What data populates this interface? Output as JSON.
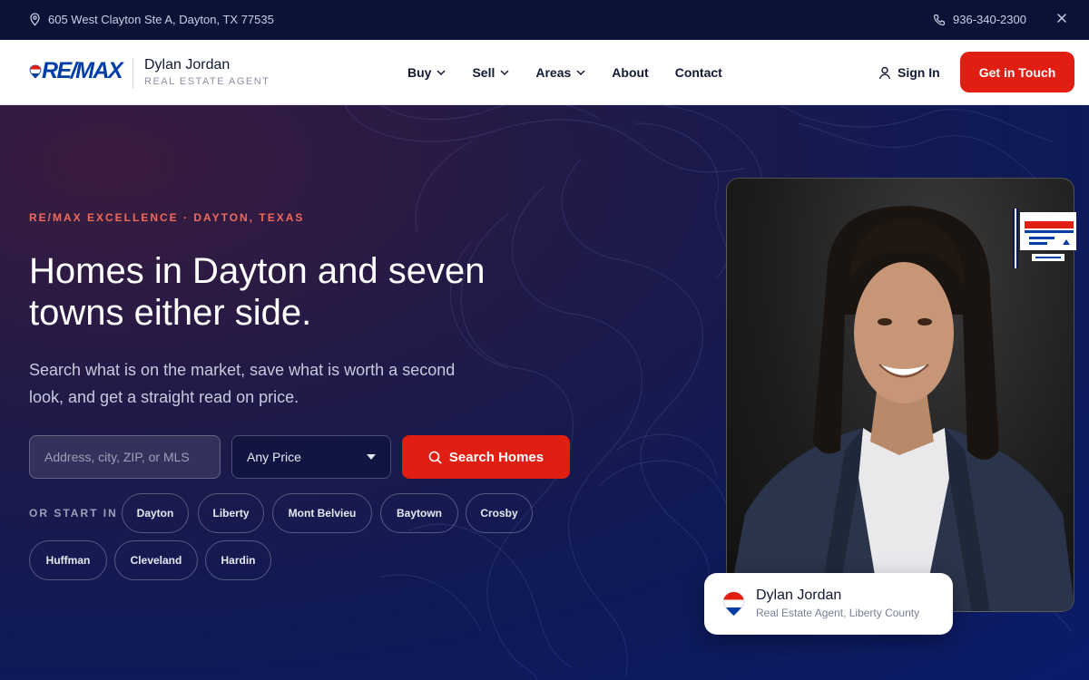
{
  "topbar": {
    "address": "605 West Clayton Ste A, Dayton, TX 77535",
    "phone": "936-340-2300",
    "address_icon": "map-pin-icon",
    "phone_icon": "phone-icon",
    "close_icon": "close-icon"
  },
  "brand": {
    "logo_text": "RE/MAX",
    "agent_name": "Dylan Jordan",
    "agent_role": "REAL ESTATE AGENT"
  },
  "nav": {
    "items": [
      {
        "label": "Buy",
        "has_dropdown": true
      },
      {
        "label": "Sell",
        "has_dropdown": true
      },
      {
        "label": "Areas",
        "has_dropdown": true
      },
      {
        "label": "About",
        "has_dropdown": false
      },
      {
        "label": "Contact",
        "has_dropdown": false
      }
    ],
    "sign_in": "Sign In",
    "cta": "Get in Touch"
  },
  "hero": {
    "eyebrow": "RE/MAX EXCELLENCE · DAYTON, TEXAS",
    "headline": "Homes in Dayton and seven towns either side.",
    "lede": "Search what is on the market, save what is worth a second look, and get a straight read on price.",
    "search_placeholder": "Address, city, ZIP, or MLS",
    "price_selected": "Any Price",
    "search_button": "Search Homes",
    "start_label": "OR START IN",
    "towns": [
      "Dayton",
      "Liberty",
      "Mont Belvieu",
      "Baytown",
      "Crosby",
      "Huffman",
      "Cleveland",
      "Hardin"
    ]
  },
  "agent_card": {
    "name": "Dylan Jordan",
    "role": "Real Estate Agent, Liberty County"
  },
  "colors": {
    "accent_red": "#e01e12",
    "brand_blue": "#003da5",
    "hero_bg": "#0b1540",
    "eyebrow": "#f06a5a"
  }
}
